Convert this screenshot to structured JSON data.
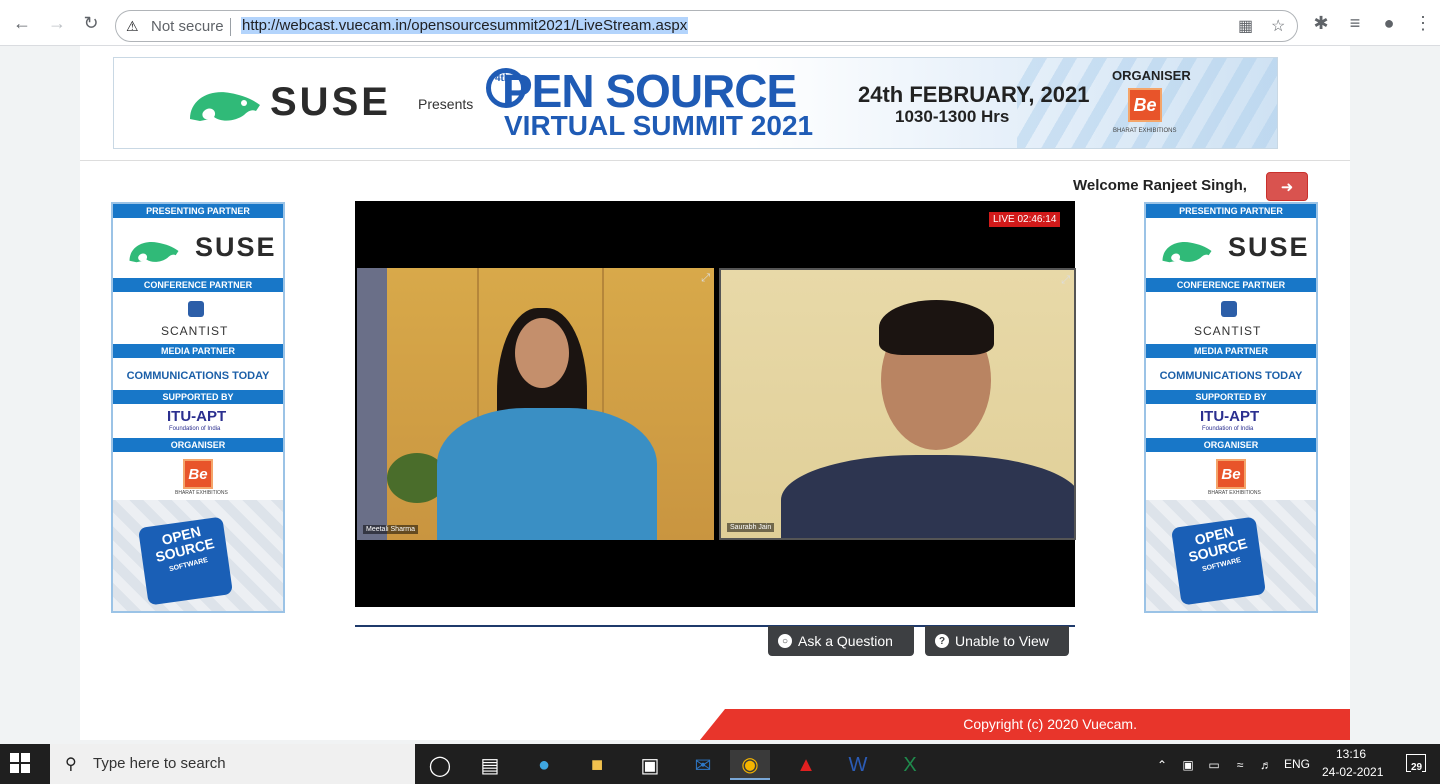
{
  "browser": {
    "security_label": "Not secure",
    "url": "http://webcast.vuecam.in/opensourcesummit2021/LiveStream.aspx"
  },
  "banner": {
    "brand": "SUSE",
    "presents": "Presents",
    "ordinal": "4th",
    "title_line1": "PEN SOURCE",
    "title_line2": "VIRTUAL SUMMIT 2021",
    "date": "24th FEBRUARY, 2021",
    "time": "1030-1300 Hrs",
    "organiser_label": "ORGANISER",
    "organiser_logo": "Be",
    "organiser_name": "BHARAT EXHIBITIONS"
  },
  "user": {
    "welcome": "Welcome Ranjeet Singh,"
  },
  "sidebar": {
    "presenting_partner": "PRESENTING PARTNER",
    "presenting_brand": "SUSE",
    "conference_partner": "CONFERENCE PARTNER",
    "conference_brand": "SCANTIST",
    "media_partner": "MEDIA PARTNER",
    "media_brand": "COMMUNICATIONS TODAY",
    "supported_by": "SUPPORTED BY",
    "support_brand": "ITU-APT",
    "support_sub": "Foundation of India",
    "organiser": "ORGANISER",
    "organiser_logo": "Be",
    "organiser_sub": "BHARAT EXHIBITIONS",
    "puzzle_line1": "OPEN",
    "puzzle_line2": "SOURCE",
    "puzzle_line3": "SOFTWARE"
  },
  "video": {
    "live_badge": "LIVE 02:46:14",
    "speakers": [
      "Meetali Sharma",
      "Saurabh Jain"
    ]
  },
  "actions": {
    "ask_question": "Ask a Question",
    "unable_to_view": "Unable to View"
  },
  "footer": {
    "copyright": "Copyright (c) 2020 Vuecam."
  },
  "taskbar": {
    "search_placeholder": "Type here to search",
    "language": "ENG",
    "time": "13:16",
    "date": "24-02-2021",
    "notification_count": "29"
  }
}
